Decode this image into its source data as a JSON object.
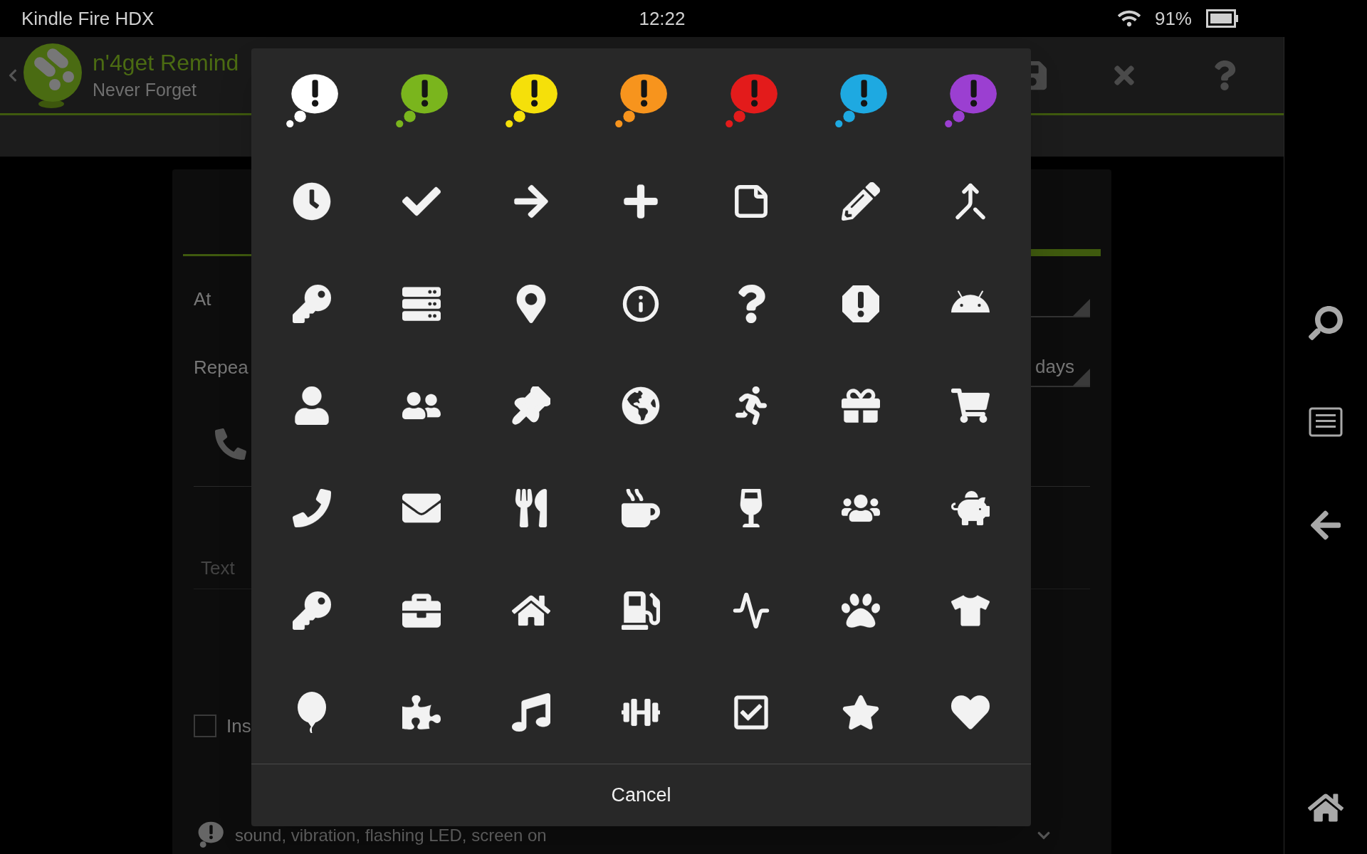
{
  "status_bar": {
    "device": "Kindle Fire HDX",
    "time": "12:22",
    "battery": "91%"
  },
  "action_bar": {
    "title": "n'4get Remind",
    "subtitle": "Never Forget"
  },
  "form": {
    "at_label": "At",
    "repeat_label": "Repea",
    "repeat_unit": "days",
    "text_placeholder": "Text",
    "insist_checkbox": {
      "label": "Ins",
      "checked": false
    },
    "alert_summary": "sound, vibration, flashing LED, screen on"
  },
  "icon_picker": {
    "bubbles": [
      {
        "color": "#ffffff"
      },
      {
        "color": "#7ab51d"
      },
      {
        "color": "#f5e00a"
      },
      {
        "color": "#f7941d"
      },
      {
        "color": "#e31b1b"
      },
      {
        "color": "#1ea9e1"
      },
      {
        "color": "#9b3fd1"
      }
    ],
    "cancel": "Cancel"
  }
}
